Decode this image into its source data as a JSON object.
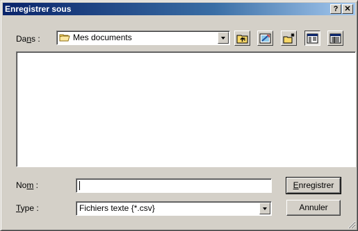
{
  "dialog": {
    "title": "Enregistrer sous",
    "help_label": "?",
    "close_label": "✕"
  },
  "location": {
    "label_before": "Da",
    "label_mnemonic": "n",
    "label_after": "s :",
    "value": "Mes documents"
  },
  "toolbar": {
    "buttons": [
      "up-one-level",
      "desktop",
      "new-folder",
      "list-view",
      "details-view"
    ]
  },
  "filename": {
    "label_before": "No",
    "label_mnemonic": "m",
    "label_after": " :",
    "value": ""
  },
  "filetype": {
    "label_mnemonic": "T",
    "label_after": "ype :",
    "value": "Fichiers texte {*.csv}"
  },
  "buttons": {
    "save_mnemonic": "E",
    "save_rest": "nregistrer",
    "cancel": "Annuler"
  },
  "colors": {
    "title_bar": "#0a246a",
    "face": "#d4d0c8"
  }
}
